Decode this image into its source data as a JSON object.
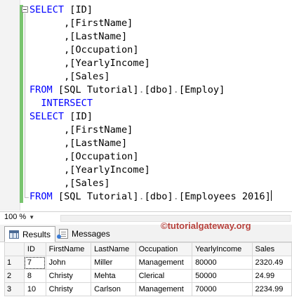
{
  "editor": {
    "lines": [
      {
        "parts": [
          {
            "t": "SELECT",
            "c": "kw"
          },
          {
            "t": " [ID]",
            "c": ""
          }
        ]
      },
      {
        "parts": [
          {
            "t": "      ,[FirstName]",
            "c": ""
          }
        ]
      },
      {
        "parts": [
          {
            "t": "      ,[LastName]",
            "c": ""
          }
        ]
      },
      {
        "parts": [
          {
            "t": "      ,[Occupation]",
            "c": ""
          }
        ]
      },
      {
        "parts": [
          {
            "t": "      ,[YearlyIncome]",
            "c": ""
          }
        ]
      },
      {
        "parts": [
          {
            "t": "      ,[Sales]",
            "c": ""
          }
        ]
      },
      {
        "parts": [
          {
            "t": "FROM",
            "c": "kw"
          },
          {
            "t": " [SQL Tutorial]",
            "c": ""
          },
          {
            "t": ".",
            "c": "gray"
          },
          {
            "t": "[dbo]",
            "c": ""
          },
          {
            "t": ".",
            "c": "gray"
          },
          {
            "t": "[Employ]",
            "c": ""
          }
        ]
      },
      {
        "parts": [
          {
            "t": "  INTERSECT",
            "c": "kw"
          }
        ]
      },
      {
        "parts": [
          {
            "t": "SELECT",
            "c": "kw"
          },
          {
            "t": " [ID]",
            "c": ""
          }
        ]
      },
      {
        "parts": [
          {
            "t": "      ,[FirstName]",
            "c": ""
          }
        ]
      },
      {
        "parts": [
          {
            "t": "      ,[LastName]",
            "c": ""
          }
        ]
      },
      {
        "parts": [
          {
            "t": "      ,[Occupation]",
            "c": ""
          }
        ]
      },
      {
        "parts": [
          {
            "t": "      ,[YearlyIncome]",
            "c": ""
          }
        ]
      },
      {
        "parts": [
          {
            "t": "      ,[Sales]",
            "c": ""
          }
        ]
      },
      {
        "parts": [
          {
            "t": "FROM",
            "c": "kw"
          },
          {
            "t": " [SQL Tutorial]",
            "c": ""
          },
          {
            "t": ".",
            "c": "gray"
          },
          {
            "t": "[dbo]",
            "c": ""
          },
          {
            "t": ".",
            "c": "gray"
          },
          {
            "t": "[Employees 2016]",
            "c": ""
          }
        ],
        "cursor": true
      }
    ]
  },
  "status": {
    "zoom": "100 %"
  },
  "tabs": {
    "results": "Results",
    "messages": "Messages"
  },
  "watermark": "©tutorialgateway.org",
  "grid": {
    "columns": [
      "ID",
      "FirstName",
      "LastName",
      "Occupation",
      "YearlyIncome",
      "Sales"
    ],
    "rows": [
      {
        "num": "1",
        "cells": [
          "7",
          "John",
          "Miller",
          "Management",
          "80000",
          "2320.49"
        ]
      },
      {
        "num": "2",
        "cells": [
          "8",
          "Christy",
          "Mehta",
          "Clerical",
          "50000",
          "24.99"
        ]
      },
      {
        "num": "3",
        "cells": [
          "10",
          "Christy",
          "Carlson",
          "Management",
          "70000",
          "2234.99"
        ]
      }
    ]
  }
}
